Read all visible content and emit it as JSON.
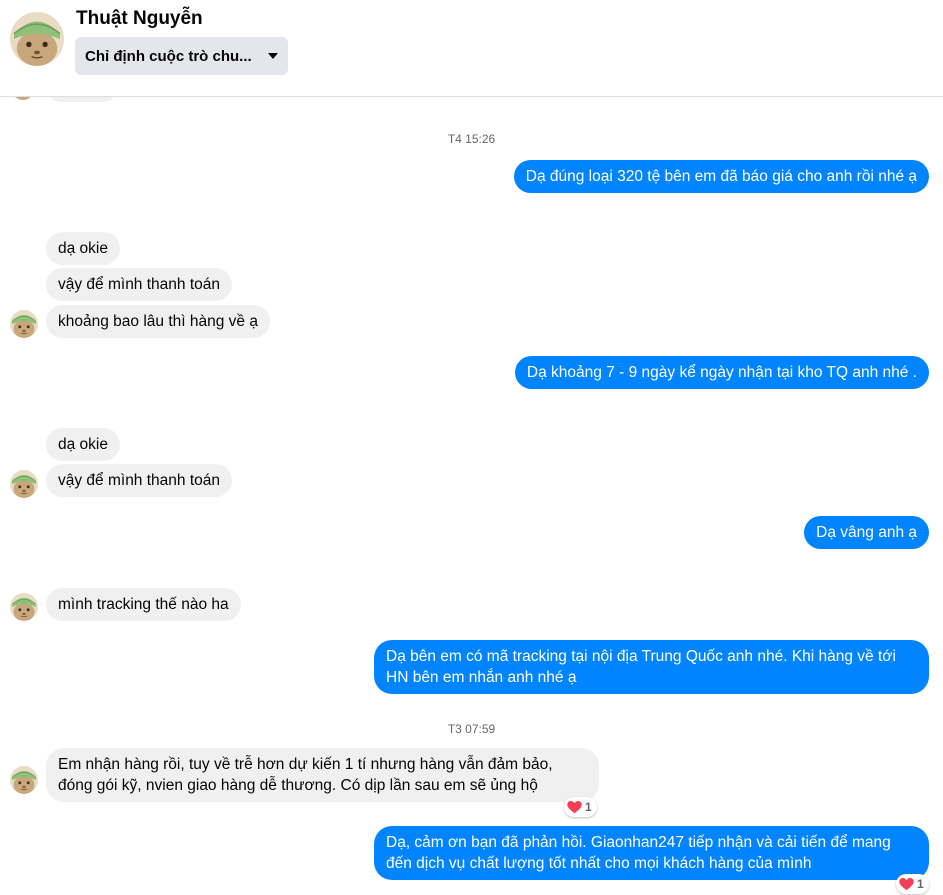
{
  "header": {
    "contact_name": "Thuật Nguyễn",
    "assign_label": "Chỉ định cuộc trò chu...",
    "avatar_icon": "cat-avatar-icon"
  },
  "colors": {
    "outgoing_bubble": "#0084ff",
    "incoming_bubble": "#f0f0f0",
    "reaction_heart": "#f33e58"
  },
  "conversation": {
    "timestamp_1": "T4 15:26",
    "msg_1": "Dạ đúng loại 320 tệ bên em đã báo giá cho anh rồi nhé ạ",
    "msg_2": "dạ okie",
    "msg_3": "vậy để mình thanh toán",
    "msg_4": "khoảng bao lâu thì hàng về ạ",
    "msg_5": "Dạ khoảng 7 - 9 ngày kể ngày nhận tại kho TQ anh nhé .",
    "msg_6": "dạ okie",
    "msg_7": "vậy để mình thanh toán",
    "msg_8": "Dạ vâng anh ạ",
    "msg_9": "mình tracking thế nào ha",
    "msg_10": "Dạ bên em có mã tracking tại nội địa Trung Quốc anh nhé. Khi hàng về tới HN bên em nhắn anh nhé ạ",
    "timestamp_2": "T3 07:59",
    "msg_11": "Em nhận hàng rồi, tuy về trễ hơn dự kiến 1 tí nhưng hàng vẫn đảm bảo, đóng gói kỹ, nvien giao hàng dễ thương. Có dịp lần sau em sẽ ủng hộ",
    "msg_11_reaction_count": "1",
    "msg_12": "Dạ, cảm ơn bạn đã phản hồi. Giaonhan247 tiếp nhận và cải tiến để mang đến dịch vụ chất lượng tốt nhất cho mọi khách hàng của mình",
    "msg_12_reaction_count": "1",
    "reaction_icon": "heart-icon"
  }
}
